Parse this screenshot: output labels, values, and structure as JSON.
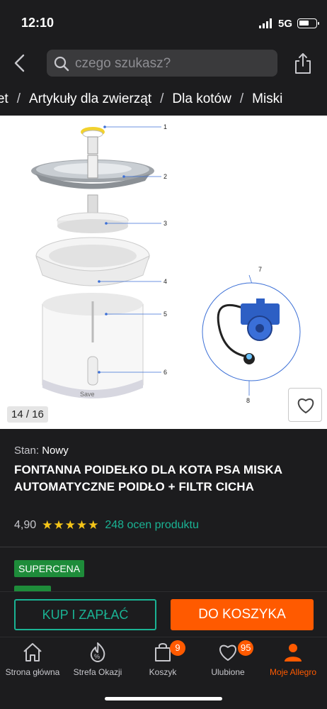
{
  "status": {
    "time": "12:10",
    "network": "5G"
  },
  "search": {
    "placeholder": "czego szukasz?"
  },
  "breadcrumb": [
    "rket",
    "Artykuły dla zwierząt",
    "Dla kotów",
    "Miski"
  ],
  "gallery": {
    "counter": "14 / 16",
    "brand_mark": "Save",
    "callouts": [
      "1",
      "2",
      "3",
      "4",
      "5",
      "6",
      "7",
      "8"
    ]
  },
  "product": {
    "condition_label": "Stan:",
    "condition_value": "Nowy",
    "title": "FONTANNA POIDEŁKO DLA KOTA PSA MISKA AUTOMATYCZNE POIDŁO + FILTR CICHA",
    "rating": "4,90",
    "stars": 5,
    "rating_count": "248 ocen produktu",
    "badge": "SUPERCENA"
  },
  "actions": {
    "buy_now": "KUP I ZAPŁAĆ",
    "add_to_cart": "DO KOSZYKA"
  },
  "tabs": [
    {
      "label": "Strona główna",
      "icon": "home-icon"
    },
    {
      "label": "Strefa Okazji",
      "icon": "discount-icon"
    },
    {
      "label": "Koszyk",
      "icon": "cart-icon",
      "badge": "9"
    },
    {
      "label": "Ulubione",
      "icon": "heart-icon",
      "badge": "95"
    },
    {
      "label": "Moje Allegro",
      "icon": "user-icon"
    }
  ],
  "colors": {
    "accent": "#ff5a00",
    "teal": "#1ab394",
    "green": "#1e8c3a",
    "star": "#f5c518"
  }
}
